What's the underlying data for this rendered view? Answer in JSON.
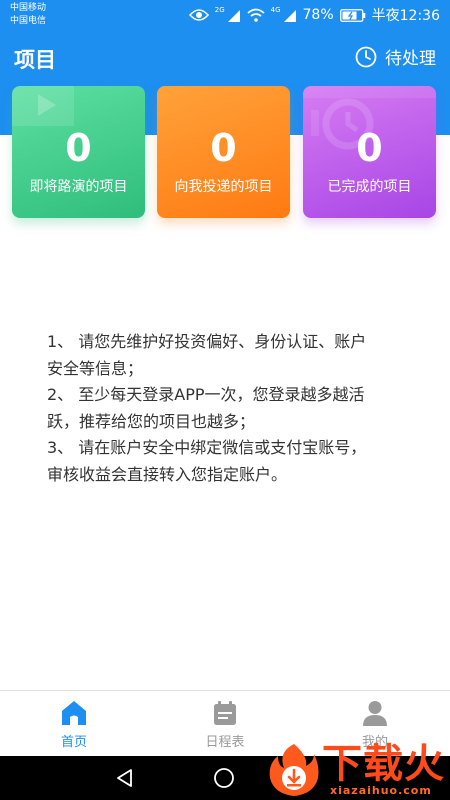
{
  "status_bar": {
    "carrier_1": "中国移动",
    "carrier_2": "中国电信",
    "network_1": "2G",
    "network_2": "4G",
    "battery": "78%",
    "time": "半夜12:36"
  },
  "header": {
    "title": "项目",
    "pending_label": "待处理"
  },
  "cards": [
    {
      "count": "0",
      "label": "即将路演的项目",
      "color": "#3cc98a",
      "icon": "play-icon"
    },
    {
      "count": "0",
      "label": "向我投递的项目",
      "color": "#ff8c22",
      "icon": "none"
    },
    {
      "count": "0",
      "label": "已完成的项目",
      "color": "#bf5eee",
      "icon": "clock-icon"
    }
  ],
  "tips": [
    "1、 请您先维护好投资偏好、身份认证、账户",
    "安全等信息；",
    "2、 至少每天登录APP一次，您登录越多越活",
    "跃，推荐给您的项目也越多；",
    "3、 请在账户安全中绑定微信或支付宝账号，",
    "审核收益会直接转入您指定账户。"
  ],
  "bottom_nav": [
    {
      "label": "首页",
      "icon": "home-icon",
      "active": true
    },
    {
      "label": "日程表",
      "icon": "calendar-icon",
      "active": false
    },
    {
      "label": "我的",
      "icon": "user-icon",
      "active": false
    }
  ],
  "watermark": {
    "text": "下载火",
    "domain": "xiazaihuo.com"
  },
  "colors": {
    "primary": "#1d8ff0",
    "watermark": "#ff4a1c"
  }
}
